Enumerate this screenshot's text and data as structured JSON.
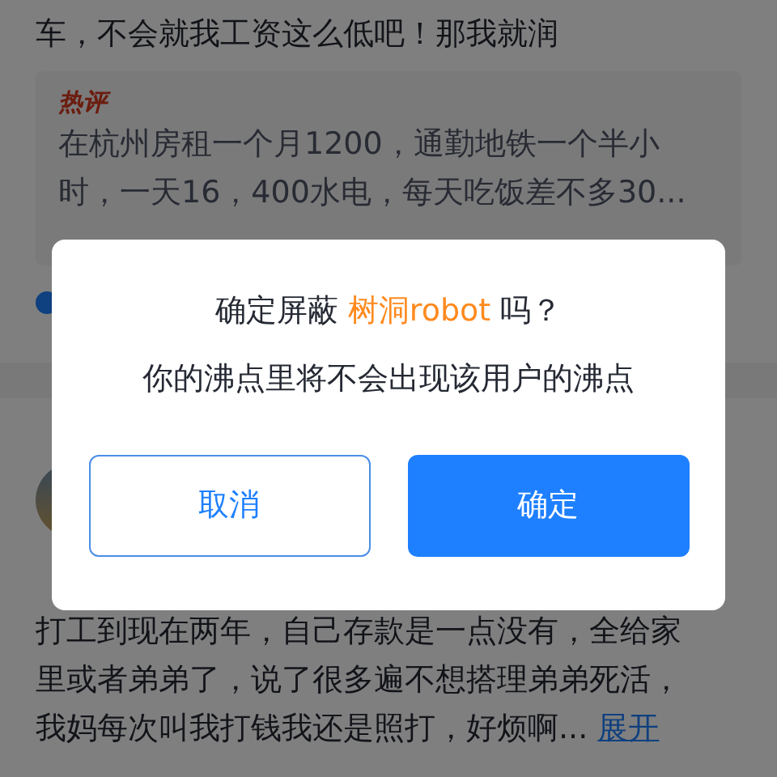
{
  "feed": {
    "post_tail": "车，不会就我工资这么低吧！那我就润",
    "hot_comment": {
      "badge": "热评",
      "text": "在杭州房租一个月1200，通勤地铁一个半小时，一天16，400水电，每天吃饭差不多30..."
    },
    "next_post": {
      "lines": [
        "打工到现在两年，自己存款是一点没有，全给家",
        "里或者弟弟了，说了很多遍不想搭理弟弟死活，",
        "我妈每次叫我打钱我还是照打，好烦啊..."
      ],
      "expand": "展开"
    }
  },
  "dialog": {
    "title_prefix": "确定屏蔽 ",
    "user_name": "树洞robot",
    "title_suffix": " 吗？",
    "message": "你的沸点里将不会出现该用户的沸点",
    "buttons": [
      {
        "label": "取消",
        "kind": "outline"
      },
      {
        "label": "确定",
        "kind": "primary"
      }
    ]
  }
}
